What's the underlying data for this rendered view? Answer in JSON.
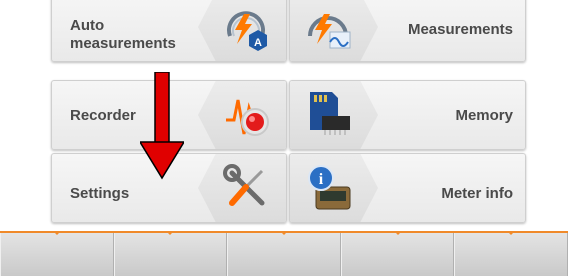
{
  "menu": {
    "auto_measurements": "Auto measurements",
    "measurements": "Measurements",
    "recorder": "Recorder",
    "memory": "Memory",
    "settings": "Settings",
    "meter_info": "Meter info"
  },
  "colors": {
    "accent": "#f08a2a",
    "arrow": "#e00000"
  }
}
